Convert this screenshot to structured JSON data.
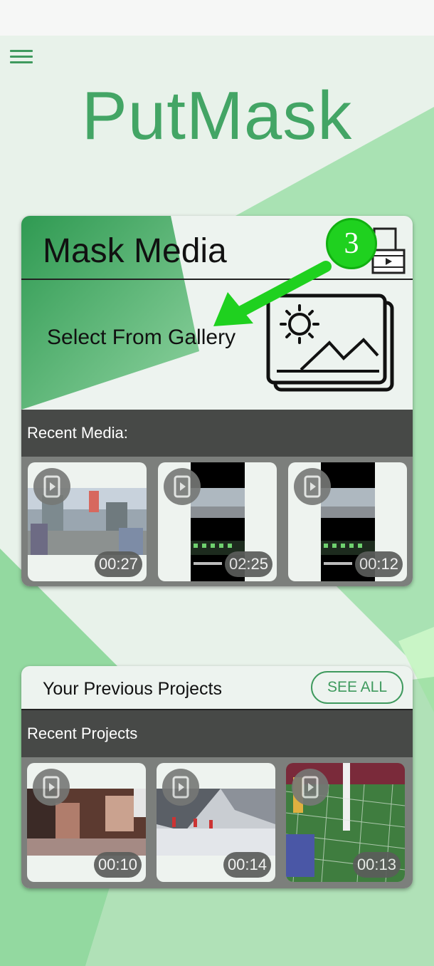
{
  "app": {
    "title": "PutMask"
  },
  "mask_media": {
    "title": "Mask Media",
    "gallery_label": "Select From Gallery",
    "recent_label": "Recent Media:",
    "items": [
      {
        "duration": "00:27"
      },
      {
        "duration": "02:25"
      },
      {
        "duration": "00:12"
      }
    ]
  },
  "projects": {
    "title": "Your Previous Projects",
    "see_all_label": "SEE ALL",
    "recent_label": "Recent Projects",
    "items": [
      {
        "duration": "00:10"
      },
      {
        "duration": "00:14"
      },
      {
        "duration": "00:13"
      }
    ]
  },
  "annotation": {
    "step_number": "3"
  },
  "colors": {
    "accent": "#43a565",
    "dark_bar": "#474947",
    "annotation_green": "#1fd11f"
  }
}
